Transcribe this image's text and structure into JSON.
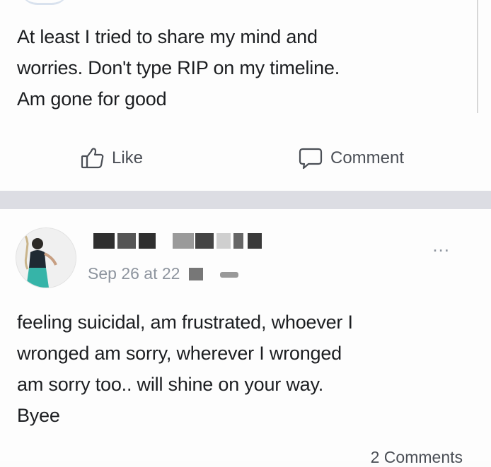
{
  "post1": {
    "text_lines": [
      "At least I tried  to share my mind and",
      "worries. Don't type RIP on my timeline.",
      "Am gone for good"
    ],
    "actions": {
      "like_label": "Like",
      "like_icon": "thumbs-up-icon",
      "comment_label": "Comment",
      "comment_icon": "comment-bubble-icon"
    }
  },
  "post2": {
    "timestamp": "Sep 26 at 22",
    "more_label": "...",
    "text_lines": [
      "feeling suicidal, am frustrated, whoever  I",
      "wronged am sorry, wherever I wronged",
      "am sorry too.. will shine on your way.",
      "Byee"
    ],
    "comments_count": "2 Comments"
  },
  "colors": {
    "text": "#1c1e21",
    "secondary_text": "#8d949e",
    "divider": "#dcdde3",
    "background": "#fdfdfd"
  }
}
